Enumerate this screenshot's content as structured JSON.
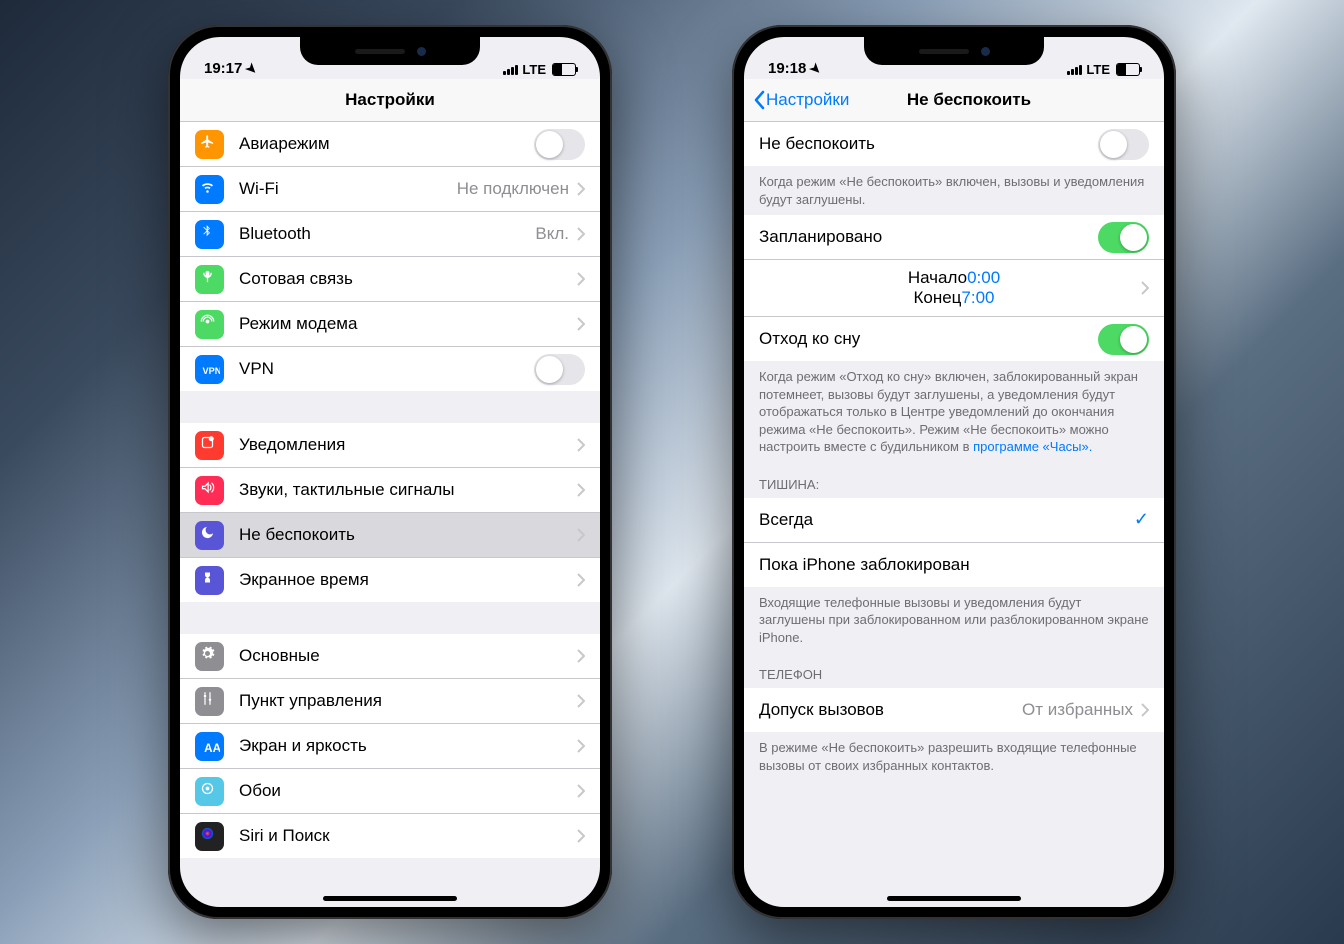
{
  "status": {
    "lte": "LTE"
  },
  "left": {
    "time": "19:17",
    "title": "Настройки",
    "groups": [
      [
        {
          "icon": "airplane",
          "bg": "#ff9500",
          "label": "Авиарежим",
          "type": "toggle",
          "on": false
        },
        {
          "icon": "wifi",
          "bg": "#007aff",
          "label": "Wi-Fi",
          "value": "Не подключен",
          "type": "nav"
        },
        {
          "icon": "bluetooth",
          "bg": "#007aff",
          "label": "Bluetooth",
          "value": "Вкл.",
          "type": "nav"
        },
        {
          "icon": "cellular",
          "bg": "#4cd964",
          "label": "Сотовая связь",
          "type": "nav"
        },
        {
          "icon": "hotspot",
          "bg": "#4cd964",
          "label": "Режим модема",
          "type": "nav"
        },
        {
          "icon": "vpn",
          "bg": "#007aff",
          "label": "VPN",
          "type": "toggle",
          "on": false
        }
      ],
      [
        {
          "icon": "notify",
          "bg": "#ff3b30",
          "label": "Уведомления",
          "type": "nav"
        },
        {
          "icon": "sounds",
          "bg": "#ff2d55",
          "label": "Звуки, тактильные сигналы",
          "type": "nav"
        },
        {
          "icon": "dnd",
          "bg": "#5856d6",
          "label": "Не беспокоить",
          "type": "nav",
          "selected": true
        },
        {
          "icon": "screentime",
          "bg": "#5856d6",
          "label": "Экранное время",
          "type": "nav"
        }
      ],
      [
        {
          "icon": "general",
          "bg": "#8e8e93",
          "label": "Основные",
          "type": "nav"
        },
        {
          "icon": "control",
          "bg": "#8e8e93",
          "label": "Пункт управления",
          "type": "nav"
        },
        {
          "icon": "display",
          "bg": "#007aff",
          "label": "Экран и яркость",
          "type": "nav"
        },
        {
          "icon": "wallpaper",
          "bg": "#55c8e8",
          "label": "Обои",
          "type": "nav"
        },
        {
          "icon": "siri",
          "bg": "#222",
          "label": "Siri и Поиск",
          "type": "nav"
        }
      ]
    ]
  },
  "right": {
    "time": "19:18",
    "back": "Настройки",
    "title": "Не беспокоить",
    "row_dnd": "Не беспокоить",
    "dnd_on": false,
    "footer_dnd": "Когда режим «Не беспокоить» включен, вызовы и уведомления будут заглушены.",
    "row_scheduled": "Запланировано",
    "scheduled_on": true,
    "time_start_label": "Начало",
    "time_start_value": "0:00",
    "time_end_label": "Конец",
    "time_end_value": "7:00",
    "row_bedtime": "Отход ко сну",
    "bedtime_on": true,
    "footer_bedtime_1": "Когда режим «Отход ко сну» включен, заблокированный экран потемнеет, вызовы будут заглушены, а уведомления будут отображаться только в Центре уведомлений до окончания режима «Не беспокоить». Режим «Не беспокоить» можно настроить вместе с будильником в ",
    "footer_bedtime_link": "программе «Часы».",
    "header_silence": "Тишина:",
    "opt_always": "Всегда",
    "opt_locked": "Пока iPhone заблокирован",
    "footer_silence": "Входящие телефонные вызовы и уведомления будут заглушены при заблокированном или разблокированном экране iPhone.",
    "header_phone": "Телефон",
    "row_allow": "Допуск вызовов",
    "row_allow_value": "От избранных",
    "footer_allow": "В режиме «Не беспокоить» разрешить входящие телефонные вызовы от своих избранных контактов."
  }
}
